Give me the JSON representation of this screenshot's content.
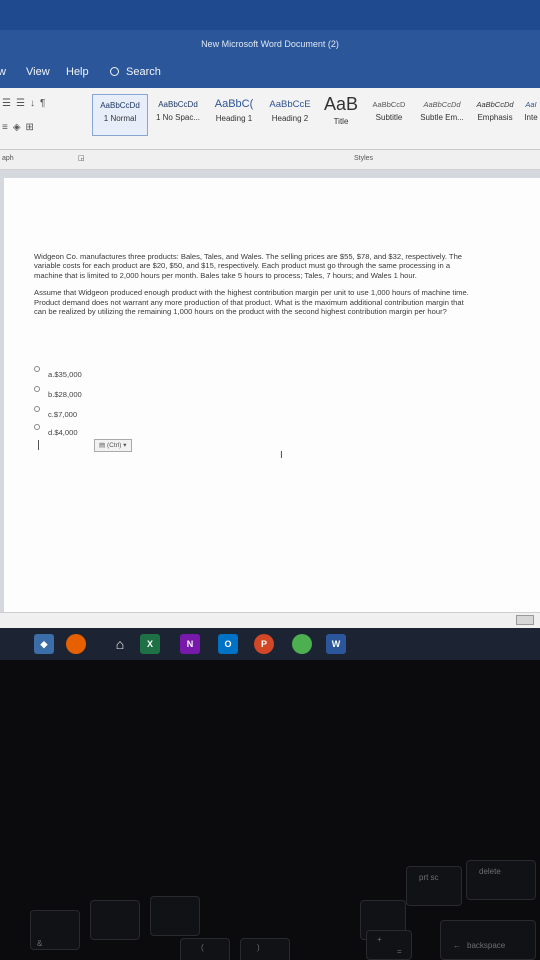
{
  "window": {
    "title": "New Microsoft Word Document (2)"
  },
  "menu": {
    "items": [
      "w",
      "View",
      "Help"
    ],
    "search_label": "Search"
  },
  "ribbon": {
    "styles": [
      {
        "preview": "AaBbCcDd",
        "name": "1 Normal"
      },
      {
        "preview": "AaBbCcDd",
        "name": "1 No Spac..."
      },
      {
        "preview": "AaBbC(",
        "name": "Heading 1"
      },
      {
        "preview": "AaBbCcE",
        "name": "Heading 2"
      },
      {
        "preview": "AaB",
        "name": "Title"
      },
      {
        "preview": "AaBbCcD",
        "name": "Subtitle"
      },
      {
        "preview": "AaBbCcDd",
        "name": "Subtle Em..."
      },
      {
        "preview": "AaBbCcDd",
        "name": "Emphasis"
      },
      {
        "preview": "AaI",
        "name": "Inte"
      }
    ],
    "group_left_label": "aph",
    "styles_group_label": "Styles"
  },
  "document": {
    "paragraph1": "Widgeon Co. manufactures three products: Bales, Tales, and Wales. The selling prices are $55, $78, and $32, respectively. The variable costs for each product are $20, $50, and $15, respectively. Each product must go through the same processing in a machine that is limited to 2,000 hours per month. Bales take 5 hours to process; Tales, 7 hours; and Wales 1 hour.",
    "paragraph2": "Assume that Widgeon produced enough product with the highest contribution margin per unit to use 1,000 hours of machine time. Product demand does not warrant any more production of that product. What is the maximum additional contribution margin that can be realized by utilizing the remaining 1,000 hours on the product with the second highest contribution margin per hour?",
    "options": [
      "a.$35,000",
      "b.$28,000",
      "c.$7,000",
      "d.$4,000"
    ],
    "paste_options": "(Ctrl)"
  },
  "taskbar": {
    "icons": [
      "X",
      "N",
      "O",
      "P",
      "W"
    ]
  },
  "keyboard": {
    "labels": [
      "prt sc",
      "delete",
      "backspace",
      "&",
      "(",
      ")",
      "+",
      "="
    ]
  },
  "colors": {
    "word_blue": "#2b579a",
    "taskbar": "#1c2333"
  }
}
